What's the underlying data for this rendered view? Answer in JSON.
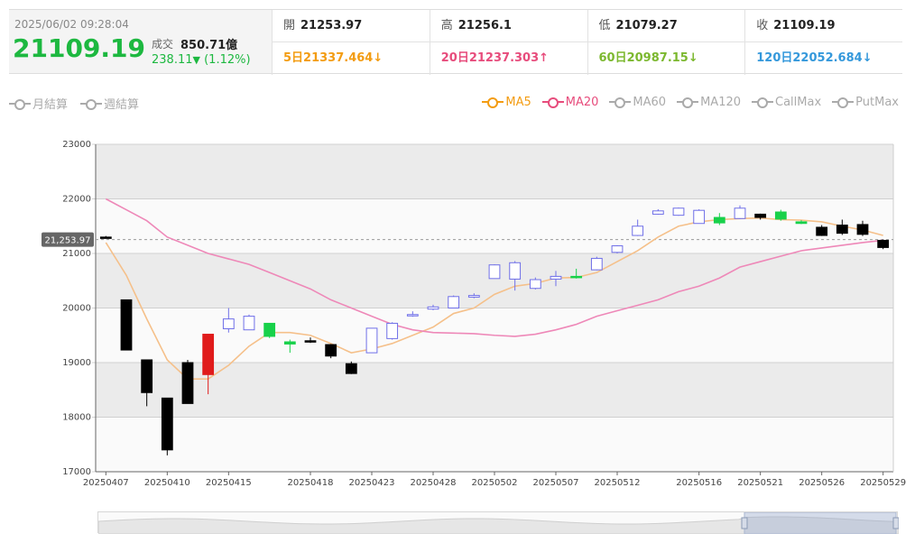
{
  "quote": {
    "datetime": "2025/06/02 09:28:04",
    "price": "21109.19",
    "volume_label": "成交",
    "volume": "850.71億",
    "change": "238.11",
    "change_arrow": "▼",
    "change_pct": "(1.12%)"
  },
  "ohlc": {
    "open_label": "開",
    "open": "21253.97",
    "high_label": "高",
    "high": "21256.1",
    "low_label": "低",
    "low": "21079.27",
    "close_label": "收",
    "close": "21109.19"
  },
  "ma_values": {
    "ma5": "5日21337.464↓",
    "ma20": "20日21237.303↑",
    "ma60": "60日20987.15↓",
    "ma120": "120日22052.684↓"
  },
  "legend": {
    "monthly": "月結算",
    "weekly": "週結算",
    "ma5": "MA5",
    "ma20": "MA20",
    "ma60": "MA60",
    "ma120": "MA120",
    "callmax": "CallMax",
    "putmax": "PutMax"
  },
  "colors": {
    "up_candle": "#e01b1b",
    "down_candle": "#000000",
    "hollow_up": "#6f6fe8",
    "green_candle": "#18d14a",
    "ma5": "#f5c08a",
    "ma20": "#ee88b8",
    "accent_green": "#1db840"
  },
  "chart_data": {
    "type": "candlestick",
    "ylim": [
      17000,
      23000
    ],
    "yticks": [
      17000,
      18000,
      19000,
      20000,
      21000,
      22000,
      23000
    ],
    "ytick_labels": [
      "17000",
      "18000",
      "19000",
      "20000",
      "21000",
      "22000",
      "23000"
    ],
    "xtick_labels": [
      "20250407",
      "20250410",
      "20250415",
      "20250418",
      "20250423",
      "20250428",
      "20250502",
      "20250507",
      "20250512",
      "20250516",
      "20250521",
      "20250526",
      "20250529"
    ],
    "current_price_label": "21,253.97",
    "current_price": 21253.97,
    "candles": [
      {
        "o": 21300,
        "h": 21320,
        "l": 21280,
        "c": 21290,
        "style": "down"
      },
      {
        "o": 20150,
        "h": 20150,
        "l": 19230,
        "c": 19230,
        "style": "down"
      },
      {
        "o": 19050,
        "h": 19050,
        "l": 18200,
        "c": 18450,
        "style": "down"
      },
      {
        "o": 18350,
        "h": 18350,
        "l": 17300,
        "c": 17400,
        "style": "down"
      },
      {
        "o": 19000,
        "h": 19050,
        "l": 18250,
        "c": 18250,
        "style": "down"
      },
      {
        "o": 18780,
        "h": 19520,
        "l": 18420,
        "c": 19520,
        "style": "up"
      },
      {
        "o": 19620,
        "h": 20000,
        "l": 19550,
        "c": 19800,
        "style": "hollow"
      },
      {
        "o": 19600,
        "h": 19880,
        "l": 19600,
        "c": 19850,
        "style": "hollow"
      },
      {
        "o": 19720,
        "h": 19720,
        "l": 19450,
        "c": 19480,
        "style": "green"
      },
      {
        "o": 19380,
        "h": 19420,
        "l": 19180,
        "c": 19340,
        "style": "green"
      },
      {
        "o": 19390,
        "h": 19460,
        "l": 19360,
        "c": 19400,
        "style": "down"
      },
      {
        "o": 19330,
        "h": 19340,
        "l": 19080,
        "c": 19120,
        "style": "down"
      },
      {
        "o": 18980,
        "h": 19020,
        "l": 18790,
        "c": 18800,
        "style": "down"
      },
      {
        "o": 19180,
        "h": 19630,
        "l": 19180,
        "c": 19630,
        "style": "hollow"
      },
      {
        "o": 19440,
        "h": 19740,
        "l": 19420,
        "c": 19720,
        "style": "hollow"
      },
      {
        "o": 19860,
        "h": 19940,
        "l": 19840,
        "c": 19880,
        "style": "hollow"
      },
      {
        "o": 19980,
        "h": 20060,
        "l": 19960,
        "c": 20020,
        "style": "hollow"
      },
      {
        "o": 20000,
        "h": 20230,
        "l": 20000,
        "c": 20210,
        "style": "hollow"
      },
      {
        "o": 20200,
        "h": 20270,
        "l": 20180,
        "c": 20230,
        "style": "hollow"
      },
      {
        "o": 20540,
        "h": 20800,
        "l": 20540,
        "c": 20790,
        "style": "hollow"
      },
      {
        "o": 20530,
        "h": 20860,
        "l": 20320,
        "c": 20830,
        "style": "hollow"
      },
      {
        "o": 20360,
        "h": 20560,
        "l": 20340,
        "c": 20520,
        "style": "hollow"
      },
      {
        "o": 20530,
        "h": 20680,
        "l": 20400,
        "c": 20580,
        "style": "hollow"
      },
      {
        "o": 20560,
        "h": 20720,
        "l": 20540,
        "c": 20580,
        "style": "green"
      },
      {
        "o": 20700,
        "h": 20940,
        "l": 20690,
        "c": 20910,
        "style": "hollow"
      },
      {
        "o": 21020,
        "h": 21150,
        "l": 21000,
        "c": 21140,
        "style": "hollow"
      },
      {
        "o": 21330,
        "h": 21620,
        "l": 21320,
        "c": 21500,
        "style": "hollow"
      },
      {
        "o": 21720,
        "h": 21810,
        "l": 21710,
        "c": 21780,
        "style": "hollow"
      },
      {
        "o": 21700,
        "h": 21840,
        "l": 21690,
        "c": 21830,
        "style": "hollow"
      },
      {
        "o": 21550,
        "h": 21810,
        "l": 21550,
        "c": 21790,
        "style": "hollow"
      },
      {
        "o": 21660,
        "h": 21740,
        "l": 21520,
        "c": 21560,
        "style": "green"
      },
      {
        "o": 21640,
        "h": 21880,
        "l": 21630,
        "c": 21830,
        "style": "hollow"
      },
      {
        "o": 21720,
        "h": 21730,
        "l": 21620,
        "c": 21660,
        "style": "down"
      },
      {
        "o": 21760,
        "h": 21800,
        "l": 21600,
        "c": 21630,
        "style": "green"
      },
      {
        "o": 21580,
        "h": 21610,
        "l": 21540,
        "c": 21550,
        "style": "green"
      },
      {
        "o": 21480,
        "h": 21520,
        "l": 21320,
        "c": 21330,
        "style": "down"
      },
      {
        "o": 21520,
        "h": 21620,
        "l": 21340,
        "c": 21370,
        "style": "down"
      },
      {
        "o": 21530,
        "h": 21600,
        "l": 21320,
        "c": 21350,
        "style": "down"
      },
      {
        "o": 21240,
        "h": 21256,
        "l": 21079,
        "c": 21109,
        "style": "down"
      }
    ],
    "series": [
      {
        "name": "MA5",
        "values": [
          21200,
          20600,
          19800,
          19050,
          18700,
          18700,
          18950,
          19300,
          19550,
          19550,
          19500,
          19350,
          19180,
          19250,
          19350,
          19500,
          19650,
          19900,
          20000,
          20250,
          20400,
          20450,
          20550,
          20560,
          20650,
          20850,
          21050,
          21300,
          21500,
          21580,
          21620,
          21640,
          21650,
          21620,
          21610,
          21580,
          21500,
          21430,
          21330
        ]
      },
      {
        "name": "MA20",
        "values": [
          22000,
          21800,
          21600,
          21300,
          21150,
          21000,
          20900,
          20800,
          20650,
          20500,
          20350,
          20150,
          20000,
          19850,
          19700,
          19600,
          19550,
          19540,
          19530,
          19500,
          19480,
          19520,
          19600,
          19700,
          19850,
          19950,
          20050,
          20150,
          20300,
          20400,
          20550,
          20750,
          20850,
          20950,
          21050,
          21100,
          21150,
          21200,
          21240
        ]
      }
    ]
  }
}
